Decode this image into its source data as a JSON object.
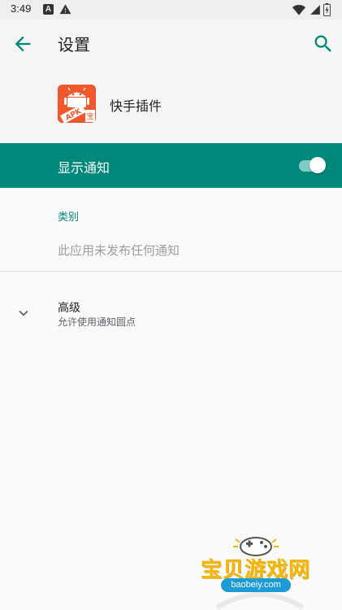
{
  "status_bar": {
    "time": "3:49",
    "notification_letter": "A",
    "icons": [
      "a-notification-icon",
      "warning-icon",
      "wifi-icon",
      "cell-signal-icon",
      "battery-icon"
    ]
  },
  "toolbar": {
    "title": "设置",
    "back_icon": "arrow-back-icon",
    "search_icon": "search-icon"
  },
  "app": {
    "name": "快手插件",
    "icon_text": "APK",
    "icon_badge": "宝"
  },
  "notifications": {
    "label": "显示通知",
    "enabled": true
  },
  "category": {
    "header": "类别",
    "empty_text": "此应用未发布任何通知"
  },
  "advanced": {
    "title": "高级",
    "subtitle": "允许使用通知圆点"
  },
  "watermark": {
    "text": "宝贝游戏网",
    "url": "baobeiy.com"
  },
  "colors": {
    "accent": "#00897b",
    "toggle_track": "#80cbc4",
    "app_icon": "#f0572a",
    "watermark_text": "#f4b400",
    "watermark_url_bg": "#1d9bd7"
  }
}
